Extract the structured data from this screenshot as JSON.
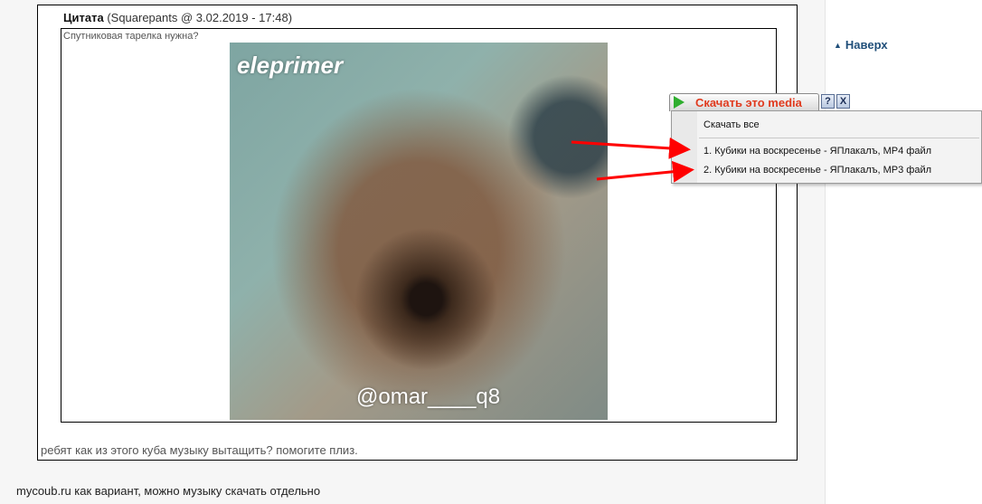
{
  "quote": {
    "label": "Цитата",
    "meta": "(Squarepants @ 3.02.2019 - 17:48)",
    "text": "Спутниковая тарелка нужна?"
  },
  "media": {
    "watermark_top": "eleprimer",
    "watermark_bottom": "@omar____q8"
  },
  "post": {
    "text": "ребят как из этого куба музыку вытащить? помогите плиз."
  },
  "reply": {
    "text": "mycoub.ru как вариант, можно музыку скачать отдельно"
  },
  "sidebar": {
    "to_top": "Наверх"
  },
  "download_menu": {
    "tab_label": "Скачать это media",
    "help": "?",
    "close": "X",
    "items": [
      "Скачать все",
      "1.  Кубики на воскресенье - ЯПлакалъ,  MP4 файл",
      "2.  Кубики на воскресенье - ЯПлакалъ,  MP3 файл"
    ]
  },
  "colors": {
    "tab_label": "#e03a1e",
    "link": "#1f4e79",
    "arrow": "#ff0000"
  }
}
